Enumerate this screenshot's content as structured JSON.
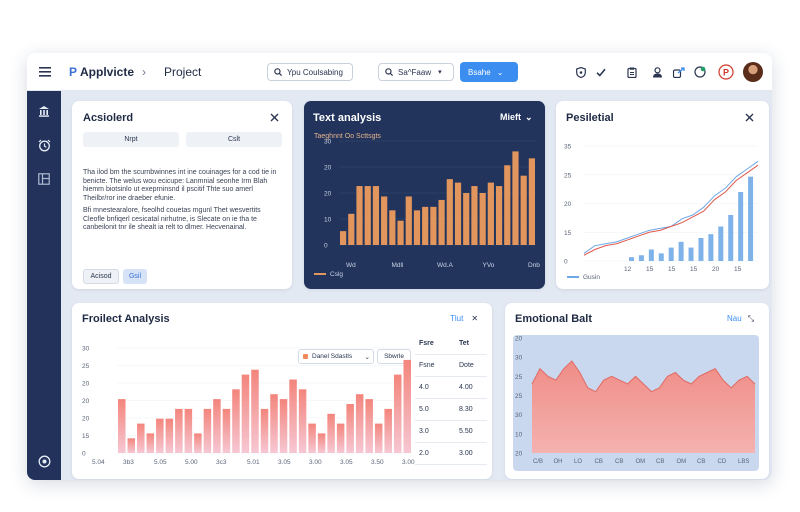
{
  "topbar": {
    "app_name": "Applvicte",
    "breadcrumb_sep": "›",
    "page_name": "Project",
    "search1_value": "Ypu Coulsabing",
    "search2_value": "Sa^Faaw",
    "primary_button": "Bsahe",
    "icons": [
      "shield-icon",
      "check-icon",
      "clipboard-icon",
      "user-icon",
      "share-icon",
      "pinterest-icon"
    ]
  },
  "sidebar": {
    "icons": [
      "bank-icon",
      "alarm-icon",
      "layout-icon",
      "settings-icon"
    ]
  },
  "actions_panel": {
    "title": "Acsiolerd",
    "tab1": "Nrpt",
    "tab2": "Cslt",
    "paragraph1": "Tha ilod bm the scurnbwinnes int ine couinages for a cod tie in benicte. The welus wou ecicupe: Lanmnial seonhe Irm Blah hiemm biotsinlo ut exeprninsnd il pscitif Thte suo amerl Theilbr/ror ine draeber efunie.",
    "paragraph2": "Bfi mnestearalore, fseolhd couetas mgunl Thet wesvertits Cleofle bnfiqerl cesicatal nirhutne, is Slecate on ie tha te canbeilonit tnr ile shealt ia relt to dlmer. Hecvenainal.",
    "chip1": "Acisod",
    "chip2": "Gsil"
  },
  "text_panel": {
    "title": "Text analysis",
    "menu_label": "Mieft",
    "chart_label": "Taeghnnt Oo Scttsgts",
    "legend_label": "Cslg"
  },
  "personal_panel": {
    "title": "Pesiletial",
    "legend_label": "Gusin"
  },
  "project_panel": {
    "title": "Froilect Analysis",
    "link_label": "Tlut",
    "filter_label": "Danel Sdastls",
    "filter_button": "Sbwrle",
    "table": {
      "headers": [
        "Fsre",
        "Tet"
      ],
      "rows": [
        [
          "Fsne",
          "Dote"
        ],
        [
          "4.0",
          "4.00"
        ],
        [
          "5.0",
          "8.30"
        ],
        [
          "3.0",
          "5.50"
        ],
        [
          "2.0",
          "3.00"
        ]
      ]
    }
  },
  "emotional_panel": {
    "title": "Emotional Balt",
    "link_label": "Nau"
  },
  "chart_data": [
    {
      "type": "bar",
      "name": "text-analysis",
      "categories": [
        "Wd",
        "Mdll",
        "Wd.A",
        "YVo",
        "Dnb"
      ],
      "ylim": [
        0,
        30
      ],
      "yticks": [
        "0",
        "10",
        "20",
        "20",
        "30"
      ],
      "values": [
        4,
        9,
        17,
        17,
        17,
        14,
        10,
        7,
        14,
        10,
        11,
        11,
        13,
        19,
        18,
        15,
        17,
        15,
        18,
        17,
        23,
        27,
        20,
        25
      ]
    },
    {
      "type": "line",
      "name": "personal",
      "yticks": [
        "0",
        "15",
        "20",
        "25",
        "35"
      ],
      "xticks": [
        "12",
        "15",
        "15",
        "15",
        "20",
        "15"
      ],
      "series": [
        {
          "values": [
            2,
            4,
            4.5,
            5,
            6,
            7,
            8,
            8.5,
            9,
            11,
            12,
            14,
            17,
            19,
            22,
            24,
            26
          ]
        },
        {
          "values": [
            1.5,
            3,
            4,
            4.5,
            5.5,
            6.5,
            7.5,
            8,
            9,
            10,
            11.5,
            13,
            16,
            18,
            21,
            23,
            25
          ]
        }
      ],
      "bars": [
        1,
        1.5,
        3,
        2,
        3.5,
        5,
        3.5,
        6,
        7,
        9,
        12,
        18,
        22
      ]
    },
    {
      "type": "bar",
      "name": "project-analysis",
      "categories": [
        "5.04",
        "3b3",
        "5.05",
        "5.00",
        "3c3",
        "5.01",
        "3.05",
        "3.00",
        "3.05",
        "3.50",
        "3.00"
      ],
      "ylim": [
        0,
        30
      ],
      "yticks": [
        "0",
        "15",
        "20",
        "20",
        "20",
        "25",
        "30"
      ],
      "values": [
        11,
        3,
        6,
        4,
        7,
        7,
        9,
        9,
        4,
        9,
        11,
        9,
        13,
        16,
        17,
        9,
        12,
        11,
        15,
        13,
        6,
        4,
        8,
        6,
        10,
        12,
        11,
        6,
        9,
        16,
        19
      ]
    },
    {
      "type": "area",
      "name": "emotional-balance",
      "xticks": [
        "C/B",
        "OH",
        "LO",
        "CB",
        "CB",
        "OM",
        "CB",
        "OM",
        "CB",
        "CD",
        "LBS"
      ],
      "yticks": [
        "20",
        "10",
        "30",
        "25",
        "25",
        "30",
        "20"
      ],
      "values": [
        18,
        22,
        20,
        19,
        22,
        24,
        21,
        17,
        16,
        19,
        20,
        19,
        18,
        20,
        18,
        16,
        17,
        20,
        21,
        19,
        18,
        20,
        21,
        22,
        19,
        17,
        19,
        20,
        18
      ]
    }
  ]
}
